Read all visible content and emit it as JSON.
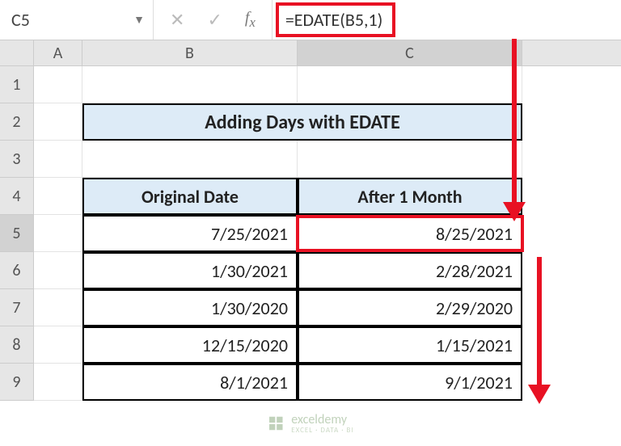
{
  "name_box": "C5",
  "formula": "=EDATE(B5,1)",
  "columns": {
    "A": "A",
    "B": "B",
    "C": "C"
  },
  "rows": [
    "1",
    "2",
    "3",
    "4",
    "5",
    "6",
    "7",
    "8",
    "9"
  ],
  "title": "Adding Days with EDATE",
  "headers": {
    "original": "Original Date",
    "after": "After 1 Month"
  },
  "data": [
    {
      "original": "7/25/2021",
      "after": "8/25/2021"
    },
    {
      "original": "1/30/2021",
      "after": "2/28/2021"
    },
    {
      "original": "1/30/2020",
      "after": "2/29/2020"
    },
    {
      "original": "12/15/2020",
      "after": "1/15/2021"
    },
    {
      "original": "8/1/2021",
      "after": "9/1/2021"
    }
  ],
  "watermark": {
    "brand": "exceldemy",
    "tagline": "EXCEL · DATA · BI"
  },
  "chart_data": {
    "type": "table",
    "title": "Adding Days with EDATE",
    "columns": [
      "Original Date",
      "After 1 Month"
    ],
    "rows": [
      [
        "7/25/2021",
        "8/25/2021"
      ],
      [
        "1/30/2021",
        "2/28/2021"
      ],
      [
        "1/30/2020",
        "2/29/2020"
      ],
      [
        "12/15/2020",
        "1/15/2021"
      ],
      [
        "8/1/2021",
        "9/1/2021"
      ]
    ],
    "formula_cell": "C5",
    "formula": "=EDATE(B5,1)"
  }
}
